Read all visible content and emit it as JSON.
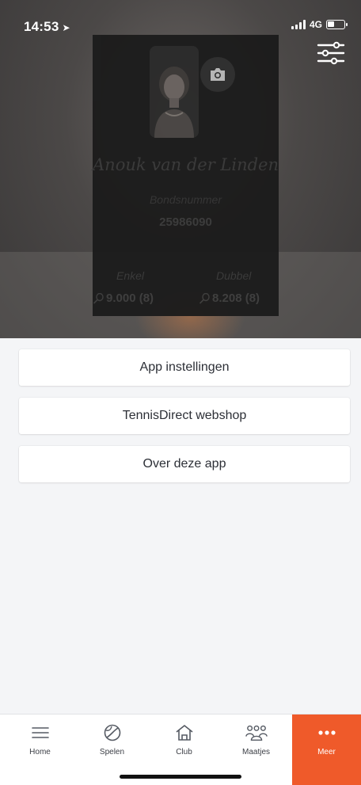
{
  "status_bar": {
    "time": "14:53",
    "network": "4G"
  },
  "profile": {
    "name": "Anouk van der Linden",
    "bond_label": "Bondsnummer",
    "bond_number": "25986090",
    "singles_label": "Enkel",
    "singles_value": "9.000 (8)",
    "doubles_label": "Dubbel",
    "doubles_value": "8.208 (8)"
  },
  "menu": {
    "items": [
      {
        "label": "App instellingen"
      },
      {
        "label": "TennisDirect webshop"
      },
      {
        "label": "Over deze app"
      }
    ]
  },
  "tabs": [
    {
      "label": "Home",
      "icon": "menu-lines-icon"
    },
    {
      "label": "Spelen",
      "icon": "tennis-ball-icon"
    },
    {
      "label": "Club",
      "icon": "house-icon"
    },
    {
      "label": "Maatjes",
      "icon": "people-icon"
    },
    {
      "label": "Meer",
      "icon": "more-dots-icon"
    }
  ],
  "colors": {
    "accent": "#ef5a2a",
    "background": "#f4f5f7",
    "header": "#4b4847"
  }
}
